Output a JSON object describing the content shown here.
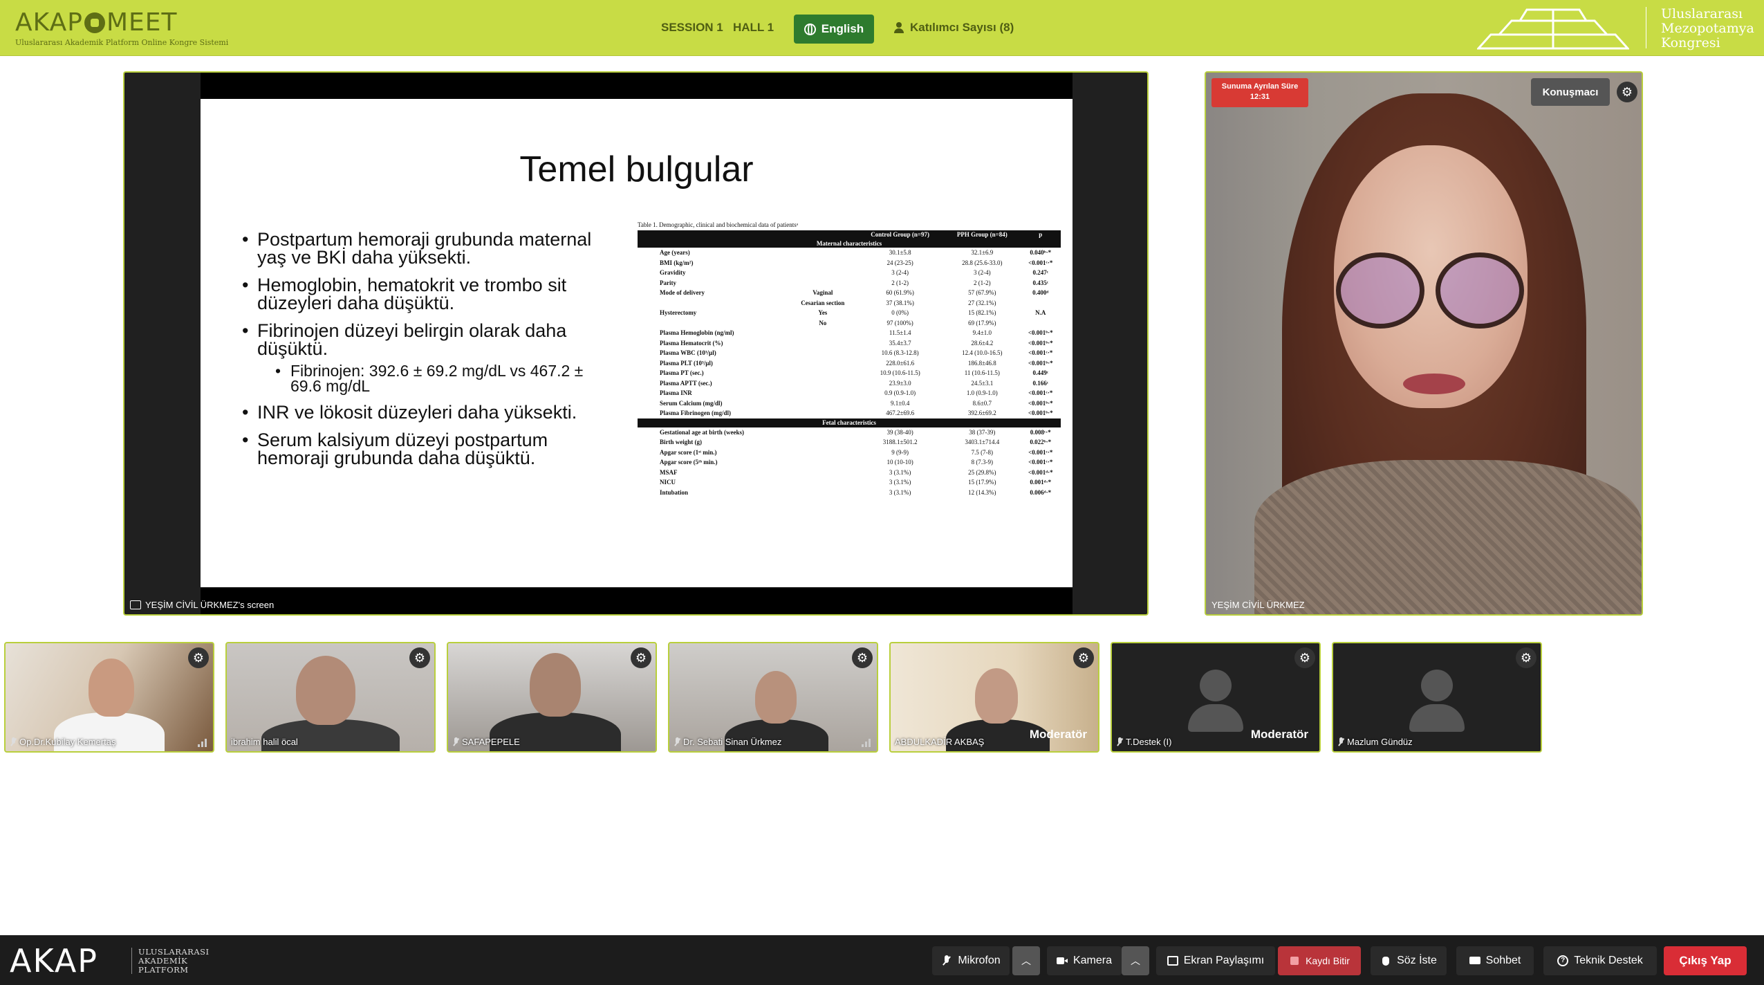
{
  "header": {
    "logo_text_left": "AKAP",
    "logo_text_right": "MEET",
    "logo_subtitle": "Uluslararası Akademik Platform Online Kongre Sistemi",
    "session": "SESSION 1",
    "hall": "HALL 1",
    "language_button": "English",
    "participants": "Katılımcı Sayısı (8)",
    "congress_name": [
      "Uluslararası",
      "Mezopotamya",
      "Kongresi"
    ]
  },
  "screen_share": {
    "owner_label": "YEŞİM CİVİL ÜRKMEZ's screen",
    "slide": {
      "title": "Temel bulgular",
      "bullets": [
        {
          "text": "Postpartum hemoraji grubunda maternal yaş ve BKİ daha yüksekti."
        },
        {
          "text": "Hemoglobin, hematokrit ve trombo sit düzeyleri daha düşüktü."
        },
        {
          "text": "Fibrinojen düzeyi belirgin olarak daha düşüktü.",
          "sub": "Fibrinojen: 392.6 ± 69.2 mg/dL vs 467.2 ± 69.6 mg/dL"
        },
        {
          "text": "INR ve lökosit düzeyleri daha yüksekti."
        },
        {
          "text": "Serum kalsiyum düzeyi postpartum hemoraji grubunda daha düşüktü."
        }
      ],
      "table": {
        "caption": "Table 1. Demographic, clinical and biochemical data of patientsᵃ",
        "headers": [
          "",
          "",
          "Control Group (n=97)",
          "PPH Group (n=84)",
          "p"
        ],
        "section1": "Maternal characteristics",
        "rows1": [
          [
            "Age (years)",
            "",
            "30.1±5.8",
            "32.1±6.9",
            "0.040ᵇ·*"
          ],
          [
            "BMI (kg/m²)",
            "",
            "24 (23-25)",
            "28.8 (25.6-33.0)",
            "<0.001ᶜ·*"
          ],
          [
            "Gravidity",
            "",
            "3 (2-4)",
            "3 (2-4)",
            "0.247ᶜ"
          ],
          [
            "Parity",
            "",
            "2 (1-2)",
            "2 (1-2)",
            "0.435ᶜ"
          ],
          [
            "Mode of delivery",
            "Vaginal",
            "60 (61.9%)",
            "57 (67.9%)",
            "0.400ᵈ"
          ],
          [
            "",
            "Cesarian section",
            "37 (38.1%)",
            "27 (32.1%)",
            ""
          ],
          [
            "Hysterectomy",
            "Yes",
            "0 (0%)",
            "15 (82.1%)",
            "N.A"
          ],
          [
            "",
            "No",
            "97 (100%)",
            "69 (17.9%)",
            ""
          ],
          [
            "Plasma Hemoglobin (ng/ml)",
            "",
            "11.5±1.4",
            "9.4±1.0",
            "<0.001ᵇ·*"
          ],
          [
            "Plasma Hematocrit (%)",
            "",
            "35.4±3.7",
            "28.6±4.2",
            "<0.001ᵇ·*"
          ],
          [
            "Plasma WBC (10³/µl)",
            "",
            "10.6 (8.3-12.8)",
            "12.4 (10.0-16.5)",
            "<0.001ᶜ·*"
          ],
          [
            "Plasma PLT (10³/µl)",
            "",
            "228.0±61.6",
            "186.8±46.8",
            "<0.001ᵇ·*"
          ],
          [
            "Plasma PT (sec.)",
            "",
            "10.9 (10.6-11.5)",
            "11 (10.6-11.5)",
            "0.449ᶜ"
          ],
          [
            "Plasma APTT (sec.)",
            "",
            "23.9±3.0",
            "24.5±3.1",
            "0.166ᶜ"
          ],
          [
            "Plasma INR",
            "",
            "0.9 (0.9-1.0)",
            "1.0 (0.9-1.0)",
            "<0.001ᶜ·*"
          ],
          [
            "Serum Calcium (mg/dl)",
            "",
            "9.1±0.4",
            "8.6±0.7",
            "<0.001ᵇ·*"
          ],
          [
            "Plasma Fibrinogen (mg/dl)",
            "",
            "467.2±69.6",
            "392.6±69.2",
            "<0.001ᵇ·*"
          ]
        ],
        "section2": "Fetal characteristics",
        "rows2": [
          [
            "Gestational age at birth (weeks)",
            "",
            "39 (38-40)",
            "38 (37-39)",
            "0.008ᶜ·*"
          ],
          [
            "Birth weight (g)",
            "",
            "3188.1±501.2",
            "3403.1±714.4",
            "0.022ᵇ·*"
          ],
          [
            "Apgar score (1ˢᵗ min.)",
            "",
            "9 (9-9)",
            "7.5 (7-8)",
            "<0.001ᶜ·*"
          ],
          [
            "Apgar score (5ᵗʰ min.)",
            "",
            "10 (10-10)",
            "8 (7.3-9)",
            "<0.001ᶜ·*"
          ],
          [
            "MSAF",
            "",
            "3 (3.1%)",
            "25 (29.8%)",
            "<0.001ᵈ·*"
          ],
          [
            "NICU",
            "",
            "3 (3.1%)",
            "15 (17.9%)",
            "0.001ᵈ·*"
          ],
          [
            "Intubation",
            "",
            "3 (3.1%)",
            "12 (14.3%)",
            "0.006ᵈ·*"
          ]
        ]
      }
    }
  },
  "speaker": {
    "timer_label": "Sunuma Ayrılan Süre",
    "timer_value": "12:31",
    "role": "Konuşmacı",
    "name": "YEŞİM CİVİL ÜRKMEZ"
  },
  "participants_list": [
    {
      "name": "Op.Dr.Kubilay Kemertaş",
      "moderator": ""
    },
    {
      "name": "ibrahim halil öcal",
      "moderator": ""
    },
    {
      "name": "SAFAPEPELE",
      "moderator": ""
    },
    {
      "name": "Dr. Sebati Sinan Ürkmez",
      "moderator": ""
    },
    {
      "name": "ABDULKADİR AKBAŞ",
      "moderator": "Moderatör"
    },
    {
      "name": "T.Destek (I)",
      "moderator": "Moderatör"
    },
    {
      "name": "Mazlum Gündüz",
      "moderator": ""
    }
  ],
  "footer": {
    "logo": "AKAP",
    "logo_sub": [
      "ULUSLARARASI",
      "AKADEMİK",
      "PLATFORM"
    ],
    "mic": "Mikrofon",
    "camera": "Kamera",
    "share": "Ekran Paylaşımı",
    "record": "Kaydı Bitir",
    "raise_hand": "Söz İste",
    "chat": "Sohbet",
    "support": "Teknik Destek",
    "exit": "Çıkış Yap"
  }
}
